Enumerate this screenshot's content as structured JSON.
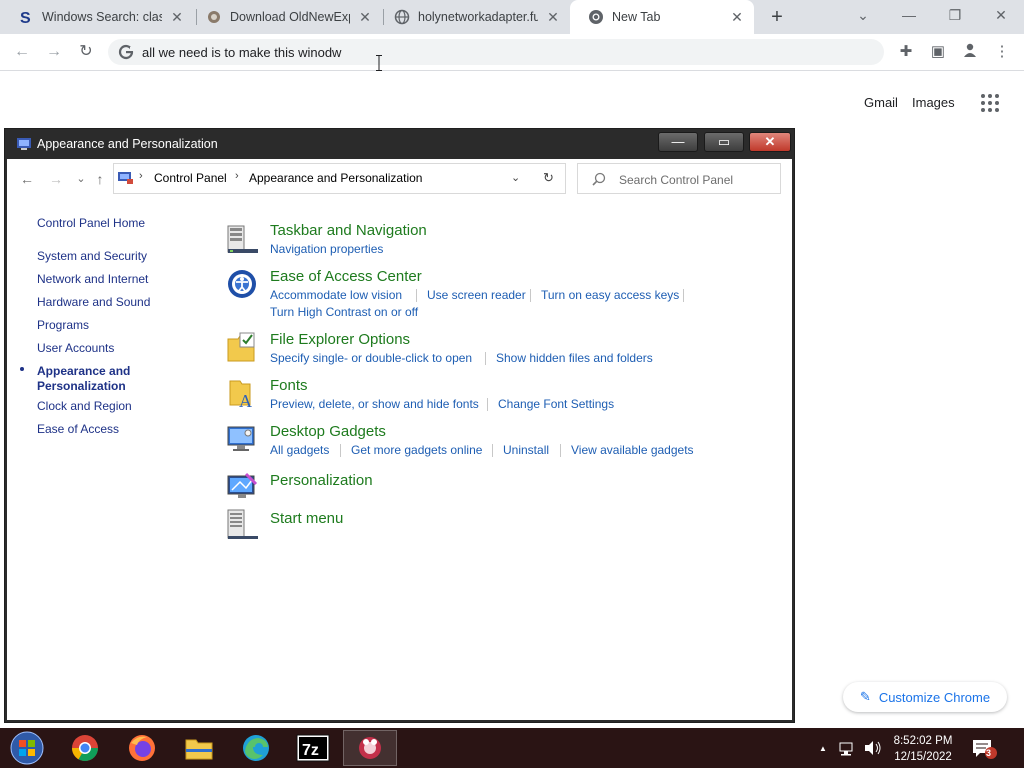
{
  "browser": {
    "tabs": [
      {
        "title": "Windows Search: classi",
        "icon": "s-logo-icon"
      },
      {
        "title": "Download OldNewExpl",
        "icon": "puzzle-icon"
      },
      {
        "title": "holynetworkadapter.fu",
        "icon": "globe-icon"
      },
      {
        "title": "New Tab",
        "icon": "chrome-icon"
      }
    ],
    "new_tab_label": "+",
    "window_controls": {
      "minimize": "—",
      "restore": "❐",
      "close": "✕",
      "tab_search": "⌄"
    },
    "omnibox_text": "all we need is to make this winodw",
    "nav": {
      "back": "←",
      "forward": "→",
      "reload": "↻"
    },
    "toolbar_icons": {
      "extensions": "✚",
      "side_panel": "▣",
      "profile": "👤",
      "menu": "⋮"
    }
  },
  "ntp": {
    "gmail": "Gmail",
    "images": "Images",
    "customize": "Customize Chrome",
    "customize_icon": "✎"
  },
  "cp": {
    "title": "Appearance and Personalization",
    "buttons": {
      "min": "—",
      "max": "▭",
      "close": "✕"
    },
    "nav": {
      "back": "←",
      "forward": "→",
      "recent": "⌄",
      "up": "↑"
    },
    "breadcrumb": [
      "Control Panel",
      "Appearance and Personalization"
    ],
    "crumb_sep": "›",
    "dropdown": "⌄",
    "refresh": "↻",
    "search_placeholder": "Search Control Panel",
    "sidebar": {
      "home": "Control Panel Home",
      "items": [
        "System and Security",
        "Network and Internet",
        "Hardware and Sound",
        "Programs",
        "User Accounts",
        "Appearance and Personalization",
        "Clock and Region",
        "Ease of Access"
      ]
    },
    "categories": [
      {
        "title": "Taskbar and Navigation",
        "tasks": [
          "Navigation properties"
        ]
      },
      {
        "title": "Ease of Access Center",
        "tasks": [
          "Accommodate low vision",
          "Use screen reader",
          "Turn on easy access keys",
          "Turn High Contrast on or off"
        ]
      },
      {
        "title": "File Explorer Options",
        "tasks": [
          "Specify single- or double-click to open",
          "Show hidden files and folders"
        ]
      },
      {
        "title": "Fonts",
        "tasks": [
          "Preview, delete, or show and hide fonts",
          "Change Font Settings"
        ]
      },
      {
        "title": "Desktop Gadgets",
        "tasks": [
          "All gadgets",
          "Get more gadgets online",
          "Uninstall",
          "View available gadgets"
        ]
      },
      {
        "title": "Personalization",
        "tasks": []
      },
      {
        "title": "Start menu",
        "tasks": []
      }
    ]
  },
  "taskbar": {
    "apps": [
      "chrome",
      "firefox",
      "file-explorer",
      "edge",
      "7-zip",
      "app"
    ],
    "app_7zip_label": "7z",
    "tray_arrow": "▲",
    "time": "8:52:02 PM",
    "date": "12/15/2022",
    "notification_count": "3"
  }
}
